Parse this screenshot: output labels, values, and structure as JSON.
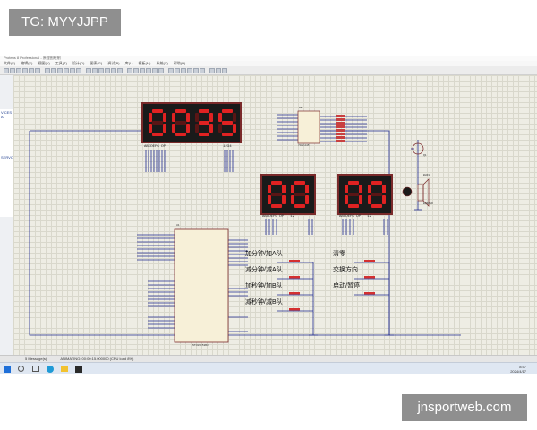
{
  "overlay": {
    "tag": "TG: MYYJJPP",
    "site": "jnsportweb.com"
  },
  "window": {
    "title": "Proteus 8 Professional - 原理图绘制",
    "menu": [
      "文件(F)",
      "编辑(E)",
      "视图(V)",
      "工具(T)",
      "设计(D)",
      "图表(G)",
      "调试(B)",
      "库(L)",
      "模板(M)",
      "系统(Y)",
      "帮助(H)"
    ]
  },
  "left_panel": {
    "items": [
      "VICES",
      "A",
      "",
      "SERVO"
    ]
  },
  "displays": {
    "main": {
      "digits": "0035",
      "pins_left": "ABCDEFG DP",
      "pins_right": "1234"
    },
    "left_score": {
      "digits": "00",
      "pins": "ABCDEFG DP   12"
    },
    "right_score": {
      "digits": "00",
      "pins": "ABCDEFG DP   12"
    }
  },
  "chips": {
    "u1": {
      "ref": "U1",
      "part": "STC89C52RC",
      "sub": "80C51"
    },
    "u2": {
      "ref": "U2",
      "part": "74HC245"
    },
    "q": {
      "ref": "Q1"
    },
    "buzzer": {
      "ref": "BUZ1",
      "label": "BUZZER"
    }
  },
  "buttons": {
    "left": [
      "加分钟/加A队",
      "减分钟/减A队",
      "加秒钟/加B队",
      "减秒钟/减B队"
    ],
    "right": [
      "清零",
      "交换方向",
      "启动/暂停"
    ]
  },
  "status": {
    "text": "ANIMATING: 00:00:15.000000 (CPU load 8%)",
    "messages": "5 Message(s)"
  },
  "clock": {
    "time": "8:57",
    "date": "2024/4/17"
  },
  "colors": {
    "seg_on": "#e02222",
    "seg_off": "#5a1515",
    "display_bg": "#1a1a1a",
    "wire": "#1f2a8f",
    "chip": "#f7f0d8"
  }
}
